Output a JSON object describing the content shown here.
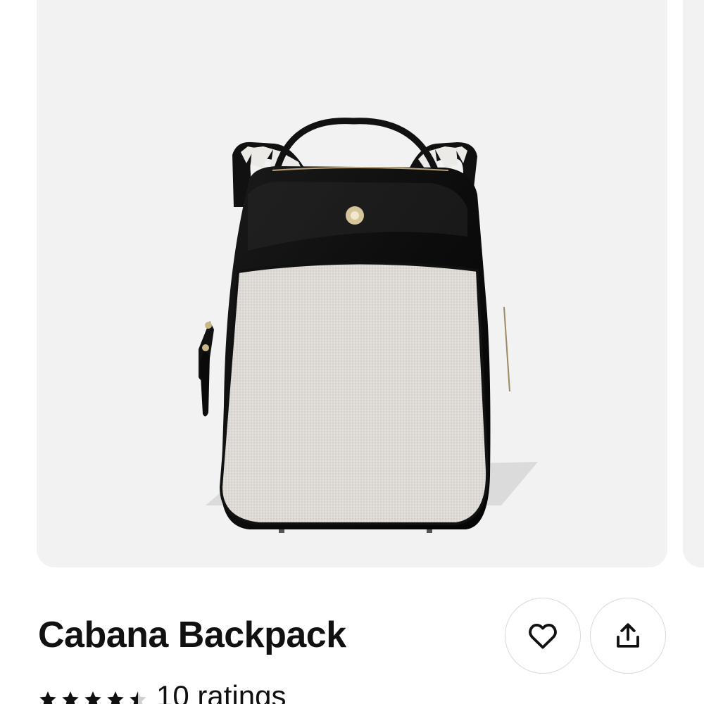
{
  "product": {
    "name": "Cabana Backpack",
    "rating": 4.5,
    "rating_max": 5,
    "ratings_label": "10 ratings"
  },
  "image": {
    "background": "#f2f2f2",
    "alt": "Cabana Backpack"
  },
  "actions": {
    "favorite_icon": "heart-outline-icon",
    "share_icon": "share-upload-icon"
  },
  "colors": {
    "text": "#111111",
    "star_filled": "#111111",
    "star_empty": "#cfcfcf",
    "button_border": "#d9d9d9"
  }
}
